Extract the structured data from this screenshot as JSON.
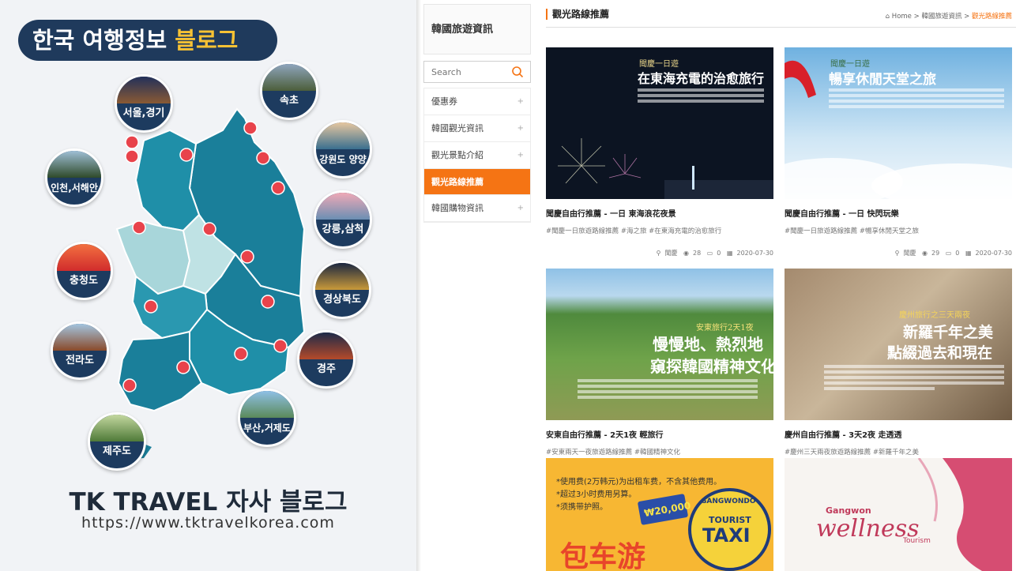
{
  "left_panel": {
    "heading_main": "한국 여행정보 ",
    "heading_highlight": "블로그",
    "regions": [
      {
        "label": "서울,경기"
      },
      {
        "label": "속초"
      },
      {
        "label": "인천,서해안"
      },
      {
        "label": "강원도 양양"
      },
      {
        "label": "강릉,삼척"
      },
      {
        "label": "충청도"
      },
      {
        "label": "경상북도"
      },
      {
        "label": "전라도"
      },
      {
        "label": "경주"
      },
      {
        "label": "부산,거제도"
      },
      {
        "label": "제주도"
      }
    ],
    "brand": "TK TRAVEL 자사 블로그",
    "url": "https://www.tktravelkorea.com"
  },
  "sidebar": {
    "title": "韓國旅遊資訊",
    "search_placeholder": "Search",
    "menu": [
      {
        "label": "優惠券",
        "active": false
      },
      {
        "label": "韓國觀光資訊",
        "active": false
      },
      {
        "label": "觀光景點介紹",
        "active": false
      },
      {
        "label": "觀光路線推薦",
        "active": true
      },
      {
        "label": "韓國購物資訊",
        "active": false
      }
    ]
  },
  "content": {
    "page_title": "觀光路線推薦",
    "breadcrumb": {
      "home": "Home",
      "sep": ">",
      "parent": "韓國旅遊資訊",
      "current": "觀光路線推薦"
    },
    "cards": [
      {
        "title": "聞慶自由行推薦 - 一日 東海浪花夜景",
        "tags": "#聞慶一日旅遊路線推薦 #海之旅 #在東海充電的治愈旅行",
        "location": "聞慶",
        "views": "28",
        "comments": "0",
        "date": "2020-07-30",
        "overlay_sub": "聞慶一日遊",
        "overlay_title": "在東海充電的治愈旅行"
      },
      {
        "title": "聞慶自由行推薦 - 一日 快閃玩樂",
        "tags": "#聞慶一日旅遊路線推薦 #暢享休閒天堂之旅",
        "location": "聞慶",
        "views": "29",
        "comments": "0",
        "date": "2020-07-30",
        "overlay_sub": "聞慶一日遊",
        "overlay_title": "暢享休閒天堂之旅"
      },
      {
        "title": "安東自由行推薦 - 2天1夜 輕旅行",
        "tags": "#安東兩天一夜旅遊路線推薦 #韓國精神文化",
        "overlay_sub": "安東旅行2天1夜",
        "overlay_line1": "慢慢地、熱烈地",
        "overlay_line2": "窺探韓國精神文化"
      },
      {
        "title": "慶州自由行推薦 - 3天2夜 走透透",
        "tags": "#慶州三天兩夜旅遊路線推薦 #新羅千年之美",
        "overlay_sub": "慶州旅行之三天兩夜",
        "overlay_line1": "新羅千年之美",
        "overlay_line2": "點綴過去和現在"
      },
      {
        "taxi_notes": [
          "*使用费(2万韩元)为出租车费，不含其他费用。",
          "*超过3小时费用另算。",
          "*须携带护照。"
        ],
        "taxi_price": "₩20,000",
        "taxi_logo_top": "GANGWONDO",
        "taxi_logo_mid": "TOURIST",
        "taxi_logo_big": "TAXI",
        "taxi_big_text": "包车游"
      },
      {
        "wellness_brand": "Gangwon",
        "wellness_script": "wellness",
        "wellness_tag": "Tourism"
      }
    ]
  },
  "colors": {
    "accent": "#f57414",
    "navy": "#1f3a5c",
    "highlight": "#f7c234",
    "map_dark": "#1a7f9a",
    "map_light": "#a8d6da"
  }
}
